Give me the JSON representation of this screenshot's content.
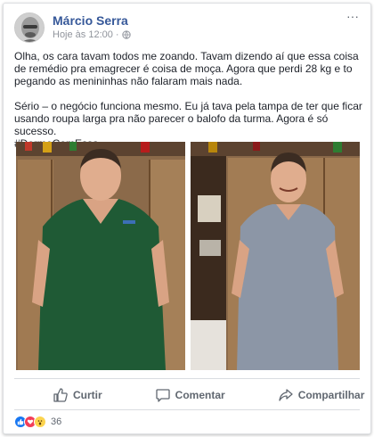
{
  "post": {
    "author": "Márcio Serra",
    "timestamp": "Hoje às 12:00",
    "separator": "·",
    "privacy_icon": "globe-icon",
    "more_label": "···",
    "text_paragraph_1": "Olha, os cara tavam todos me zoando. Tavam dizendo aí que essa coisa de remédio pra emagrecer é coisa de moça. Agora que perdi 28 kg e to pegando as menininhas não falaram mais nada.",
    "text_paragraph_2": "Sério – o negócio funciona mesmo. Eu já tava pela tampa de ter que ficar usando roupa larga pra não parecer o balofo da turma. Agora é só sucesso.",
    "hashtag": "#DormeComEssa"
  },
  "actions": {
    "like_label": "Curtir",
    "comment_label": "Comentar",
    "share_label": "Compartilhar"
  },
  "reactions": {
    "icons": [
      "like-icon",
      "love-icon",
      "wow-icon"
    ],
    "count": "36"
  },
  "colors": {
    "author_link": "#365899",
    "like_blue": "#1877f2",
    "love_red": "#f33e58",
    "wow_yellow": "#fcd44f"
  }
}
